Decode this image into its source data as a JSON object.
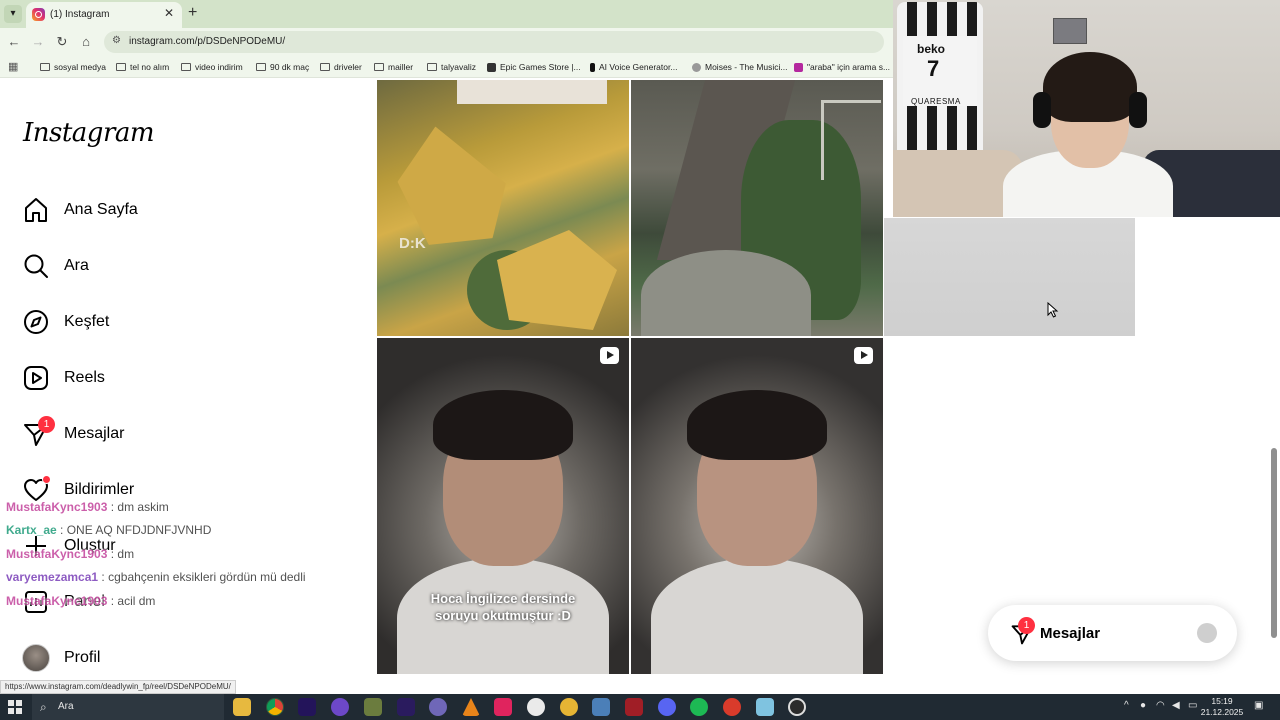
{
  "browser": {
    "tab_title": "(1) Instagram",
    "url": "instagram.com/p/DSDeNPODeMU/",
    "bookmarks": [
      {
        "label": "sosyal medya",
        "type": "folder"
      },
      {
        "label": "tel no alım",
        "type": "folder"
      },
      {
        "label": "video indirim",
        "type": "folder"
      },
      {
        "label": "90 dk maç",
        "type": "folder"
      },
      {
        "label": "driveler",
        "type": "folder"
      },
      {
        "label": "mailler",
        "type": "folder"
      },
      {
        "label": "talyavaliz",
        "type": "folder"
      },
      {
        "label": "Epic Games Store |...",
        "type": "site"
      },
      {
        "label": "AI Voice Generator...",
        "type": "site"
      },
      {
        "label": "Moises - The Musici...",
        "type": "site"
      },
      {
        "label": "\"araba\" için arama s...",
        "type": "site"
      }
    ],
    "status_url": "https://www.instagram.com/deadlywin_fp/reel/DSDeNPODeMU/"
  },
  "instagram": {
    "logo": "Instagram",
    "nav": [
      {
        "label": "Ana Sayfa",
        "icon": "home-icon"
      },
      {
        "label": "Ara",
        "icon": "search-icon"
      },
      {
        "label": "Keşfet",
        "icon": "compass-icon"
      },
      {
        "label": "Reels",
        "icon": "reels-icon"
      },
      {
        "label": "Mesajlar",
        "icon": "messenger-icon",
        "badge": "1"
      },
      {
        "label": "Bildirimler",
        "icon": "heart-icon",
        "dot": true
      },
      {
        "label": "Oluştur",
        "icon": "plus-icon"
      },
      {
        "label": "Panel",
        "icon": "dashboard-icon"
      },
      {
        "label": "Profil",
        "icon": "avatar-icon"
      }
    ],
    "tiles": {
      "tile1_overlay": "D:K",
      "tile4_caption_line1": "Hoca İngilizce dersinde",
      "tile4_caption_line2": "soruyu okutmuştur :D"
    },
    "messages_pill": {
      "label": "Mesajlar",
      "badge": "1"
    }
  },
  "stream_overlay": {
    "jersey_brand": "beko",
    "jersey_number": "7",
    "jersey_name": "QUARESMA",
    "chat": [
      {
        "user": "MustafaKync1903",
        "message": "dm askim",
        "color": "#c3449c"
      },
      {
        "user": "Kartx_ae",
        "message": "ONE AQ NFDJDNFJVNHD",
        "color": "#1f9c7a"
      },
      {
        "user": "MustafaKync1903",
        "message": "dm",
        "color": "#c3449c"
      },
      {
        "user": "varyemezamca1",
        "message": "cgbahçenin eksikleri gördün mü dedli",
        "color": "#7a3fb8"
      },
      {
        "user": "MustafaKync1903",
        "message": "acil dm",
        "color": "#c3449c"
      }
    ]
  },
  "taskbar": {
    "search_placeholder": "Ara",
    "time": "15:19",
    "date": "21.12.2025"
  },
  "colors": {
    "badge": "#ff3040",
    "tabstrip": "#d3e3c9",
    "toolbar": "#f0f6ec",
    "taskbar": "#202a33"
  }
}
